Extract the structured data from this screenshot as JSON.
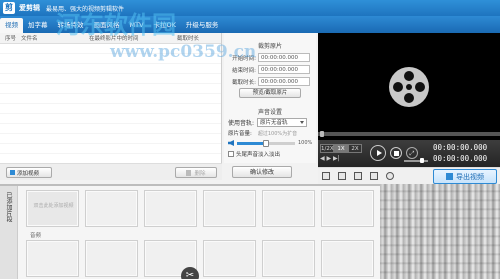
{
  "app": {
    "name": "爱剪辑",
    "slogan": "最易用、强大的视频剪辑软件",
    "watermark": "河东软件园",
    "watermark_url": "www.pc0359.cn"
  },
  "tabs": [
    "视频",
    "加字幕",
    "转场特效",
    "画面风格",
    "MTV",
    "卡拉OK",
    "升级与服务"
  ],
  "list": {
    "headers": [
      "序号",
      "文件名",
      "在最终影片中的时间",
      "截取时长"
    ]
  },
  "cut": {
    "title": "裁剪原片",
    "start_label": "开始时间:",
    "start_value": "00:00:00.000",
    "end_label": "结束时间:",
    "end_value": "00:00:00.000",
    "duration_label": "截取时长:",
    "duration_value": "00:00:00.000",
    "preview_button": "预览/截取原片"
  },
  "sound": {
    "title": "声音设置",
    "track_label": "使用音轨:",
    "track_value": "原片无音轨",
    "volume_label": "原片音量:",
    "volume_hint": "超过100%为扩音",
    "volume_value": "100%",
    "volume_level": 0.5,
    "fade_label": "头尾声音淡入淡出"
  },
  "confirm_button": "确认修改",
  "left_actions": {
    "add_video": "添加视频",
    "delete": "删除"
  },
  "player": {
    "speeds": [
      "1/2X",
      "1X",
      "2X"
    ],
    "time_current": "00:00:00.000",
    "time_total": "00:00:00.000",
    "volume_level": 0.75
  },
  "export_button": "导出视频",
  "storyboard": {
    "label": "已添加片段",
    "hint": "双击此处添加视频",
    "audio_label": "音频"
  },
  "colors": {
    "titlebar": "#1e74bf",
    "accent": "#2e8ad4",
    "preview_bg": "#000000"
  }
}
